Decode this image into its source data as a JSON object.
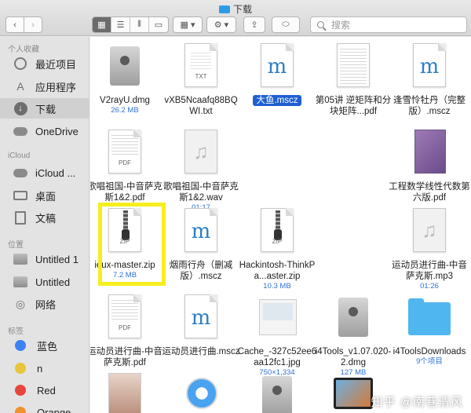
{
  "window": {
    "title": "下载"
  },
  "toolbar": {
    "back_glyph": "‹",
    "forward_glyph": "›",
    "view_icons": [
      "grid-icon",
      "list-icon",
      "columns-icon",
      "gallery-icon"
    ],
    "group_glyph": "▦ ▾",
    "action_glyph": "⚙ ▾",
    "share_glyph": "⇪",
    "tag_glyph": "⬭",
    "search_placeholder": "搜索"
  },
  "sidebar": {
    "favorites_header": "个人收藏",
    "favorites": [
      {
        "label": "最近项目",
        "icon": "clock-icon"
      },
      {
        "label": "应用程序",
        "icon": "apps-icon"
      },
      {
        "label": "下载",
        "icon": "download-icon",
        "selected": true
      },
      {
        "label": "OneDrive",
        "icon": "cloud-icon"
      }
    ],
    "icloud_header": "iCloud",
    "icloud": [
      {
        "label": "iCloud ...",
        "icon": "cloud-icon"
      },
      {
        "label": "桌面",
        "icon": "desktop-icon"
      },
      {
        "label": "文稿",
        "icon": "document-icon"
      }
    ],
    "locations_header": "位置",
    "locations": [
      {
        "label": "Untitled 1",
        "icon": "disk-icon"
      },
      {
        "label": "Untitled",
        "icon": "disk-icon"
      },
      {
        "label": "网络",
        "icon": "network-icon"
      }
    ],
    "tags_header": "标签",
    "tags": [
      {
        "label": "蓝色",
        "color": "#3b82f6"
      },
      {
        "label": "n",
        "color": "#e8c53a"
      },
      {
        "label": "Red",
        "color": "#e8453c"
      },
      {
        "label": "Orange",
        "color": "#f0932b"
      }
    ]
  },
  "files": [
    {
      "name": "V2rayU.dmg",
      "meta": "26.2 MB",
      "kind": "dmg"
    },
    {
      "name": "vXB5Ncaafq88BQWI.txt",
      "meta": "",
      "kind": "txt",
      "label": "TXT"
    },
    {
      "name": "大鱼.mscz",
      "meta": "",
      "kind": "mscz",
      "selected": true
    },
    {
      "name": "第05讲 逆矩阵和分块矩阵...pdf",
      "meta": "",
      "kind": "pdfthumb"
    },
    {
      "name": "逢雪怜牡丹（完整版）.mscz",
      "meta": "",
      "kind": "mscz"
    },
    {
      "name": "歌唱祖国-中音萨克斯1&2.pdf",
      "meta": "",
      "kind": "pdf",
      "label": "PDF"
    },
    {
      "name": "歌唱祖国-中音萨克斯1&2.wav",
      "meta": "01:17",
      "kind": "audio"
    },
    {
      "name": "",
      "meta": "",
      "kind": "empty"
    },
    {
      "name": "",
      "meta": "",
      "kind": "empty"
    },
    {
      "name": "工程数学线性代数第六版.pdf",
      "meta": "",
      "kind": "book"
    },
    {
      "name": "ieux-master.zip",
      "meta": "7.2 MB",
      "kind": "zip",
      "label": "ZIP"
    },
    {
      "name": "烟雨行舟（删减版）.mscz",
      "meta": "",
      "kind": "mscz"
    },
    {
      "name": "Hackintosh-ThinkPa...aster.zip",
      "meta": "10.3 MB",
      "kind": "zip",
      "label": "ZIP"
    },
    {
      "name": "",
      "meta": "",
      "kind": "empty"
    },
    {
      "name": "运动员进行曲-中音萨克斯.mp3",
      "meta": "01:26",
      "kind": "audio"
    },
    {
      "name": "运动员进行曲-中音萨克斯.pdf",
      "meta": "",
      "kind": "pdf",
      "label": "PDF"
    },
    {
      "name": "运动员进行曲.mscz",
      "meta": "",
      "kind": "mscz"
    },
    {
      "name": "Cache_-327c52ee6aa12fc1.jpg",
      "meta": "750×1,334",
      "kind": "jpg"
    },
    {
      "name": "i4Tools_v1.07.020-2.dmg",
      "meta": "127 MB",
      "kind": "dmg"
    },
    {
      "name": "i4ToolsDownloads",
      "meta": "9个项目",
      "kind": "folder"
    },
    {
      "name": "",
      "meta": "",
      "kind": "photo"
    },
    {
      "name": "",
      "meta": "",
      "kind": "safari"
    },
    {
      "name": "",
      "meta": "",
      "kind": "dmg"
    },
    {
      "name": "",
      "meta": "",
      "kind": "ipad"
    }
  ],
  "watermark": "知乎 @南巷清风",
  "highlight_color": "#f6ee1f"
}
